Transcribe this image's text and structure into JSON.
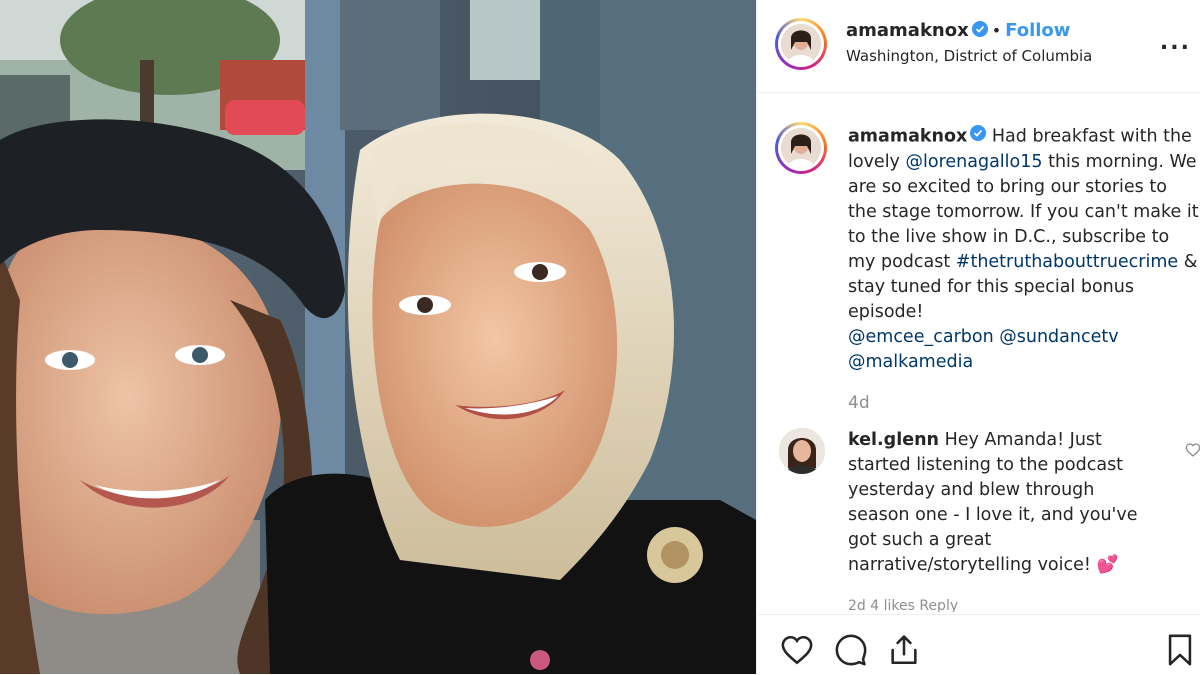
{
  "post": {
    "username": "amamaknox",
    "follow_label": "Follow",
    "separator": "•",
    "location": "Washington, District of Columbia",
    "more_label": "..."
  },
  "caption": {
    "username": "amamaknox",
    "text_1": "Had breakfast with the lovely",
    "mention_1": "@lorenagallo15",
    "text_2": "this morning. We are so excited to bring our stories to the stage tomorrow. If you can't make it to the live show in D.C., subscribe to my podcast",
    "hashtag": "#thetruthabouttruecrime",
    "text_3": "& stay tuned for this special bonus episode!",
    "mention_2": "@emcee_carbon",
    "mention_3": "@sundancetv",
    "mention_4": "@malkamedia",
    "time": "4d"
  },
  "comment": {
    "username": "kel.glenn",
    "text": "Hey Amanda! Just started listening to the podcast yesterday and blew through season one - I love it, and you've got such a great narrative/storytelling voice! 💕",
    "meta": "2d   4 likes   Reply"
  },
  "colors": {
    "accent": "#3897f0",
    "link": "#00376b",
    "muted": "#8e8e8e",
    "verified": "#3897f0"
  },
  "icons": [
    "verified-badge-icon",
    "more-options-icon",
    "heart-icon",
    "comment-icon",
    "share-icon",
    "bookmark-icon"
  ]
}
